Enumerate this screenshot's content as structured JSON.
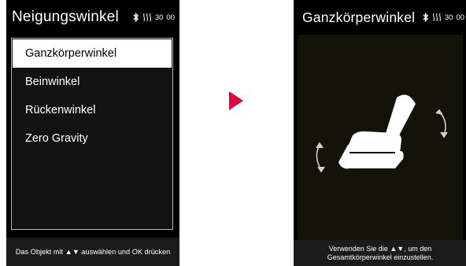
{
  "left_screen": {
    "title": "Neigungswinkel",
    "battery_text": "30",
    "timer_text": "00",
    "menu_items": [
      {
        "label": "Ganzkörperwinkel",
        "selected": true
      },
      {
        "label": "Beinwinkel",
        "selected": false
      },
      {
        "label": "Rückenwinkel",
        "selected": false
      },
      {
        "label": "Zero Gravity",
        "selected": false
      }
    ],
    "hint_before": "Das Objekt mit",
    "hint_after": "auswählen und OK drücken",
    "hint_arrow_up": "▲",
    "hint_arrow_down": "▼"
  },
  "right_screen": {
    "title": "Ganzkörperwinkel",
    "battery_text": "30",
    "timer_text": "00",
    "hint_line1_before": "Verwenden Sie die",
    "hint_line1_after": ", um den",
    "hint_arrow_up": "▲",
    "hint_arrow_down": "▼",
    "hint_line2": "Gesamtkörperwinkel einzustellen."
  },
  "colors": {
    "accent_arrow": "#e2003c",
    "screen_bg": "#000000",
    "selected_bg": "#ffffff"
  },
  "icons": {
    "bluetooth": "bluetooth-icon",
    "heat": "heat-icon",
    "next": "next-arrow-icon",
    "chair": "recliner-chair-icon",
    "rotate_ccw": "rotate-left-icon",
    "rotate_cw": "rotate-right-icon"
  }
}
